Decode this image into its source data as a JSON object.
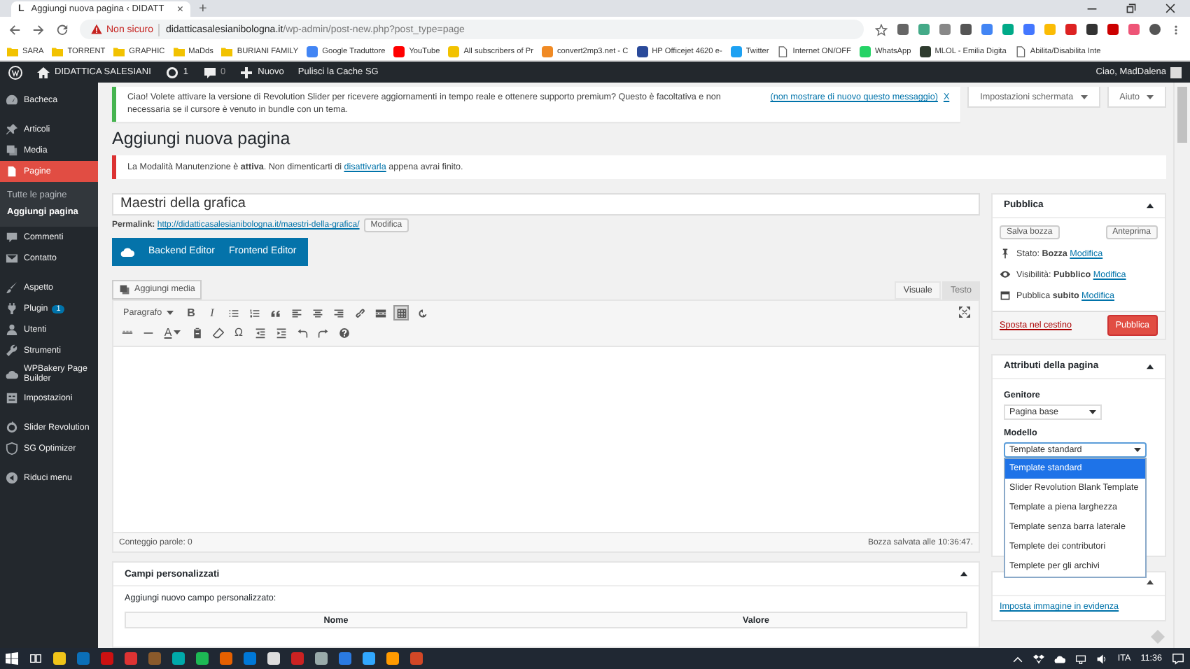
{
  "browser": {
    "tab": {
      "favicon": "L",
      "title": "Aggiungi nuova pagina ‹ DIDATT",
      "close": "×"
    },
    "new_tab": "+",
    "address": {
      "security": "Non sicuro",
      "host": "didatticasalesianibologna.it",
      "path": "/wp-admin/post-new.php?post_type=page"
    },
    "bookmarks": [
      {
        "kind": "folder",
        "label": "SARA"
      },
      {
        "kind": "folder",
        "label": "TORRENT"
      },
      {
        "kind": "folder",
        "label": "GRAPHIC"
      },
      {
        "kind": "folder",
        "label": "MaDds"
      },
      {
        "kind": "folder",
        "label": "BURIANI FAMILY"
      },
      {
        "kind": "site",
        "label": "Google Traduttore",
        "color": "#4285f4"
      },
      {
        "kind": "site",
        "label": "YouTube",
        "color": "#ff0000"
      },
      {
        "kind": "site",
        "label": "All subscribers of Pr",
        "color": "#f2c200"
      },
      {
        "kind": "site",
        "label": "convert2mp3.net - C",
        "color": "#f08a24"
      },
      {
        "kind": "site",
        "label": "HP Officejet 4620 e-",
        "color": "#2a4a9a"
      },
      {
        "kind": "site",
        "label": "Twitter",
        "color": "#1da1f2"
      },
      {
        "kind": "page",
        "label": "Internet ON/OFF"
      },
      {
        "kind": "site",
        "label": "WhatsApp",
        "color": "#25d366"
      },
      {
        "kind": "site",
        "label": "MLOL - Emilia Digita",
        "color": "#2e3b2e"
      },
      {
        "kind": "page",
        "label": "Abilita/Disabilita Inte"
      }
    ]
  },
  "admin_bar": {
    "site": "DIDATTICA SALESIANI",
    "updates": "1",
    "comments": "0",
    "new": "Nuovo",
    "cache": "Pulisci la Cache SG",
    "greeting": "Ciao, MadDalena"
  },
  "sidebar": {
    "groups": [
      {
        "items": [
          {
            "label": "Bacheca",
            "selected": false
          }
        ]
      },
      {
        "items": [
          {
            "label": "Articoli",
            "selected": false
          },
          {
            "label": "Media",
            "selected": false
          },
          {
            "label": "Pagine",
            "selected": true,
            "children": [
              {
                "label": "Tutte le pagine",
                "selected": false
              },
              {
                "label": "Aggiungi pagina",
                "selected": true
              }
            ]
          },
          {
            "label": "Commenti",
            "selected": false
          },
          {
            "label": "Contatto",
            "selected": false
          }
        ]
      },
      {
        "items": [
          {
            "label": "Aspetto",
            "selected": false
          },
          {
            "label": "Plugin",
            "selected": false,
            "badge": "1"
          },
          {
            "label": "Utenti",
            "selected": false
          },
          {
            "label": "Strumenti",
            "selected": false
          },
          {
            "label": "WPBakery Page Builder",
            "selected": false
          },
          {
            "label": "Impostazioni",
            "selected": false
          }
        ]
      },
      {
        "items": [
          {
            "label": "Slider Revolution",
            "selected": false
          },
          {
            "label": "SG Optimizer",
            "selected": false
          }
        ]
      },
      {
        "items": [
          {
            "label": "Riduci menu",
            "selected": false
          }
        ]
      }
    ]
  },
  "slider_notice": {
    "text": "Ciao! Volete attivare la versione di Revolution Slider per ricevere aggiornamenti in tempo reale e ottenere supporto premium? Questo è facoltativa e non necessaria se il cursore è venuto in bundle con un tema.",
    "dismiss": "(non mostrare di nuovo questo messaggio)",
    "close": "X"
  },
  "screen_options": [
    {
      "label": "Impostazioni schermata"
    },
    {
      "label": "Aiuto"
    }
  ],
  "page_title": "Aggiungi nuova pagina",
  "maintenance_notice": {
    "before": "La Modalità Manutenzione è **attiva**. Non dimenticarti di",
    "link": "disattivarla",
    "after": "appena avrai finito."
  },
  "editor": {
    "title": "Maestri della grafica",
    "permalink_label": "Permalink:",
    "permalink_url": "http://didatticasalesianibologna.it/maestri-della-grafica/",
    "permalink_edit": "Modifica",
    "builder": [
      "Backend Editor",
      "Frontend Editor"
    ],
    "add_media": "Aggiungi media",
    "tabs": [
      {
        "label": "Visuale",
        "selected": true
      },
      {
        "label": "Testo",
        "selected": false
      }
    ],
    "format": "Paragrafo",
    "toolbar": [
      [
        {
          "kind": "bold",
          "label": "B",
          "pressed": false
        },
        {
          "kind": "italic",
          "label": "I",
          "pressed": false
        },
        {
          "kind": "ul",
          "pressed": false
        },
        {
          "kind": "ol",
          "pressed": false
        },
        {
          "kind": "quote",
          "pressed": false
        },
        {
          "kind": "alignleft",
          "pressed": false
        },
        {
          "kind": "aligncenter",
          "pressed": false
        },
        {
          "kind": "alignright",
          "pressed": false
        },
        {
          "kind": "link",
          "pressed": false
        },
        {
          "kind": "more",
          "pressed": false
        },
        {
          "kind": "toggle",
          "pressed": true
        },
        {
          "kind": "refresh",
          "pressed": false
        }
      ],
      [
        {
          "kind": "strike",
          "pressed": false
        },
        {
          "kind": "hr",
          "pressed": false
        },
        {
          "kind": "color",
          "label": "A",
          "pressed": false
        },
        {
          "kind": "paste",
          "pressed": false
        },
        {
          "kind": "eraser",
          "pressed": false
        },
        {
          "kind": "omega",
          "label": "Ω",
          "pressed": false
        },
        {
          "kind": "outdent",
          "pressed": false
        },
        {
          "kind": "indent",
          "pressed": false
        },
        {
          "kind": "undo",
          "pressed": false
        },
        {
          "kind": "redo",
          "pressed": false
        },
        {
          "kind": "help",
          "pressed": false
        }
      ]
    ],
    "word_count": "Conteggio parole: 0",
    "saved": "Bozza salvata alle 10:36:47."
  },
  "custom_fields": {
    "title": "Campi personalizzati",
    "subtitle": "Aggiungi nuovo campo personalizzato:",
    "columns": [
      "Nome",
      "Valore"
    ]
  },
  "publish": {
    "title": "Pubblica",
    "save_draft": "Salva bozza",
    "preview": "Anteprima",
    "rows": [
      {
        "label": "Stato:",
        "value": "Bozza",
        "link": "Modifica"
      },
      {
        "label": "Visibilità:",
        "value": "Pubblico",
        "link": "Modifica"
      },
      {
        "label": "Pubblica",
        "value": "subito",
        "link": "Modifica"
      }
    ],
    "trash": "Sposta nel cestino",
    "publish": "Pubblica"
  },
  "attributes": {
    "title": "Attributi della pagina",
    "parent_label": "Genitore",
    "parent_value": "Pagina base",
    "template_label": "Modello",
    "template_value": "Template standard",
    "template_open": true,
    "template_options": [
      {
        "label": "Template standard",
        "selected": true
      },
      {
        "label": "Slider Revolution Blank Template",
        "selected": false
      },
      {
        "label": "Template a piena larghezza",
        "selected": false
      },
      {
        "label": "Template senza barra laterale",
        "selected": false
      },
      {
        "label": "Templete dei contributori",
        "selected": false
      },
      {
        "label": "Templete per gli archivi",
        "selected": false
      }
    ]
  },
  "featured": {
    "link": "Imposta immagine in evidenza"
  },
  "taskbar": {
    "language": "ITA",
    "time": "11:36"
  }
}
